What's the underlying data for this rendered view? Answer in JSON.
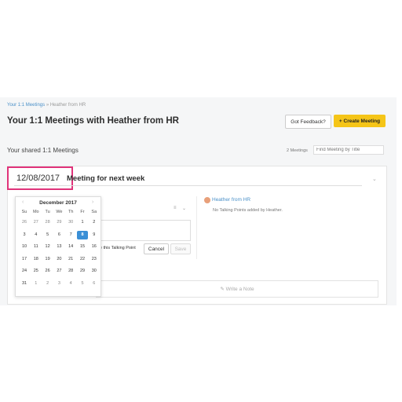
{
  "breadcrumb": {
    "link": "Your 1:1 Meetings",
    "separator": "»",
    "current": "Heather from HR"
  },
  "page_title": "Your 1:1 Meetings with Heather from HR",
  "buttons": {
    "feedback": "Got Feedback?",
    "create_icon": "+",
    "create": "Create Meeting",
    "cancel": "Cancel",
    "save": "Save"
  },
  "shared_heading": "Your shared 1:1 Meetings",
  "meetings_count": "2 Meetings",
  "search_placeholder": "Find Meeting by Title",
  "meeting": {
    "date": "12/08/2017",
    "title": "Meeting for next week"
  },
  "right_panel": {
    "name": "Heather from HR",
    "empty_text": "No Talking Points added by Heather."
  },
  "talking_point_label": "e this Talking Point",
  "note_placeholder": "✎ Write a Note",
  "icons": {
    "prev": "‹",
    "next": "›",
    "chevron": "⌄",
    "menu": "≡"
  },
  "calendar": {
    "month": "December 2017",
    "weekdays": [
      "Su",
      "Mo",
      "Tu",
      "We",
      "Th",
      "Fr",
      "Sa"
    ],
    "weeks": [
      [
        "26",
        "27",
        "28",
        "29",
        "30",
        "1",
        "2"
      ],
      [
        "3",
        "4",
        "5",
        "6",
        "7",
        "8",
        "9"
      ],
      [
        "10",
        "11",
        "12",
        "13",
        "14",
        "15",
        "16"
      ],
      [
        "17",
        "18",
        "19",
        "20",
        "21",
        "22",
        "23"
      ],
      [
        "24",
        "25",
        "26",
        "27",
        "28",
        "29",
        "30"
      ],
      [
        "31",
        "1",
        "2",
        "3",
        "4",
        "5",
        "6"
      ]
    ],
    "muted": [
      [
        0,
        0
      ],
      [
        0,
        1
      ],
      [
        0,
        2
      ],
      [
        0,
        3
      ],
      [
        0,
        4
      ],
      [
        5,
        1
      ],
      [
        5,
        2
      ],
      [
        5,
        3
      ],
      [
        5,
        4
      ],
      [
        5,
        5
      ],
      [
        5,
        6
      ]
    ],
    "selected": [
      1,
      5
    ]
  },
  "colors": {
    "accent": "#4a90c8",
    "highlight": "#e0337a",
    "create_button": "#f5c518",
    "selected_day": "#3a8fd6"
  }
}
